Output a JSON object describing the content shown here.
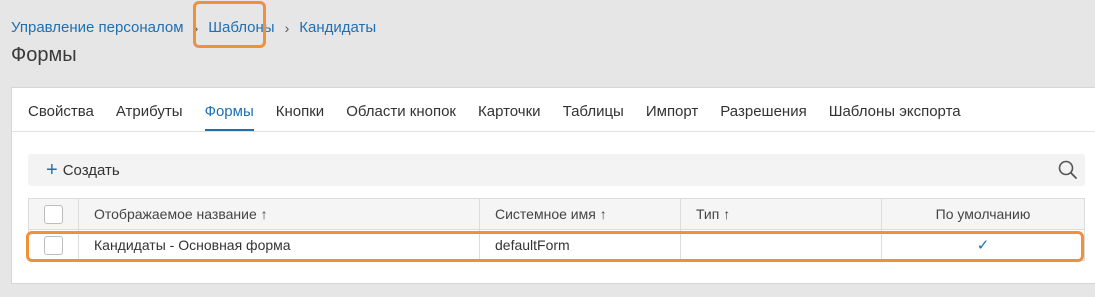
{
  "breadcrumb": {
    "items": [
      "Управление персоналом",
      "Шаблоны",
      "Кандидаты"
    ]
  },
  "page": {
    "title": "Формы"
  },
  "tabs": [
    {
      "label": "Свойства"
    },
    {
      "label": "Атрибуты"
    },
    {
      "label": "Формы",
      "active": true
    },
    {
      "label": "Кнопки"
    },
    {
      "label": "Области кнопок"
    },
    {
      "label": "Карточки"
    },
    {
      "label": "Таблицы"
    },
    {
      "label": "Импорт"
    },
    {
      "label": "Разрешения"
    },
    {
      "label": "Шаблоны экспорта"
    }
  ],
  "toolbar": {
    "create_label": "Создать",
    "create_icon": "plus-icon",
    "search_icon": "search-icon"
  },
  "table": {
    "columns": [
      "Отображаемое название ↑",
      "Системное имя ↑",
      "Тип ↑",
      "По умолчанию"
    ],
    "rows": [
      {
        "display_name": "Кандидаты - Основная форма",
        "system_name": "defaultForm",
        "type": "",
        "default": "✓"
      }
    ]
  },
  "colors": {
    "accent": "#1f6fb2",
    "highlight": "#f0913a",
    "background": "#e6e6e6"
  }
}
